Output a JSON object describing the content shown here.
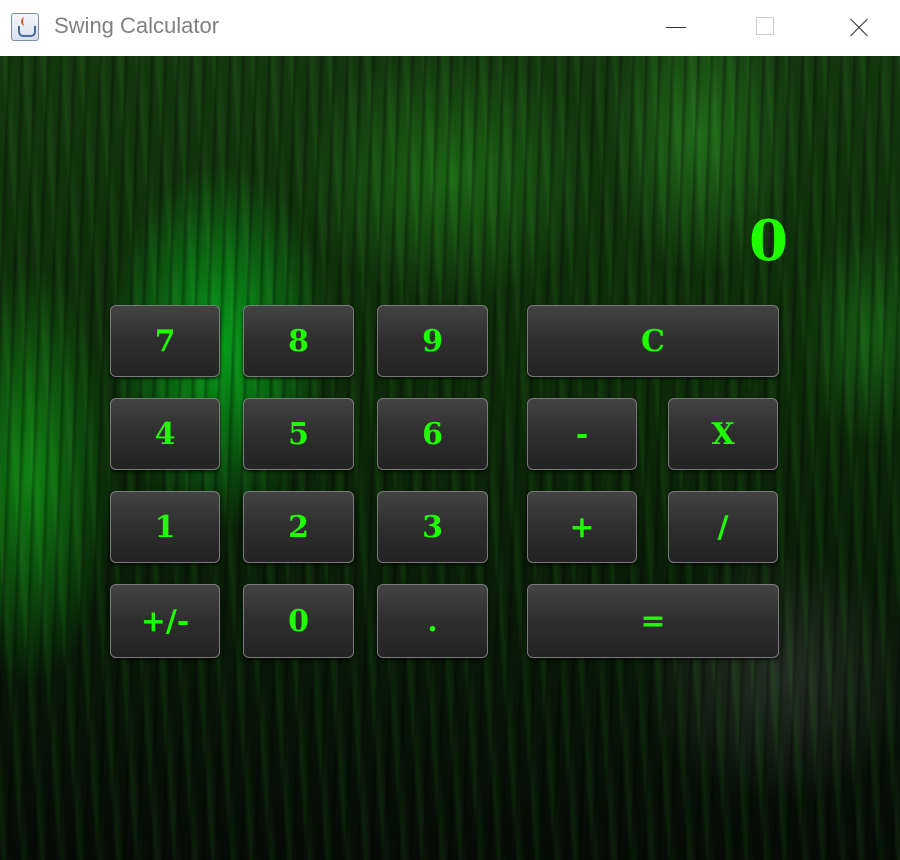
{
  "window": {
    "title": "Swing Calculator",
    "icon": "java-icon",
    "controls": [
      "minimize-icon",
      "maximize-icon",
      "close-icon"
    ]
  },
  "display": {
    "value": "0"
  },
  "keys": {
    "seven": "7",
    "eight": "8",
    "nine": "9",
    "clear": "C",
    "four": "4",
    "five": "5",
    "six": "6",
    "minus": "-",
    "multiply": "X",
    "one": "1",
    "two": "2",
    "three": "3",
    "plus": "+",
    "divide": "/",
    "negate": "+/-",
    "zero": "0",
    "decimal": ".",
    "equals": "="
  },
  "colors": {
    "accent": "#1eff00",
    "button_bg": "#2e2e2e",
    "button_border": "#7a7a7a",
    "titlebar_bg": "#ffffff",
    "title_text": "#808080"
  }
}
